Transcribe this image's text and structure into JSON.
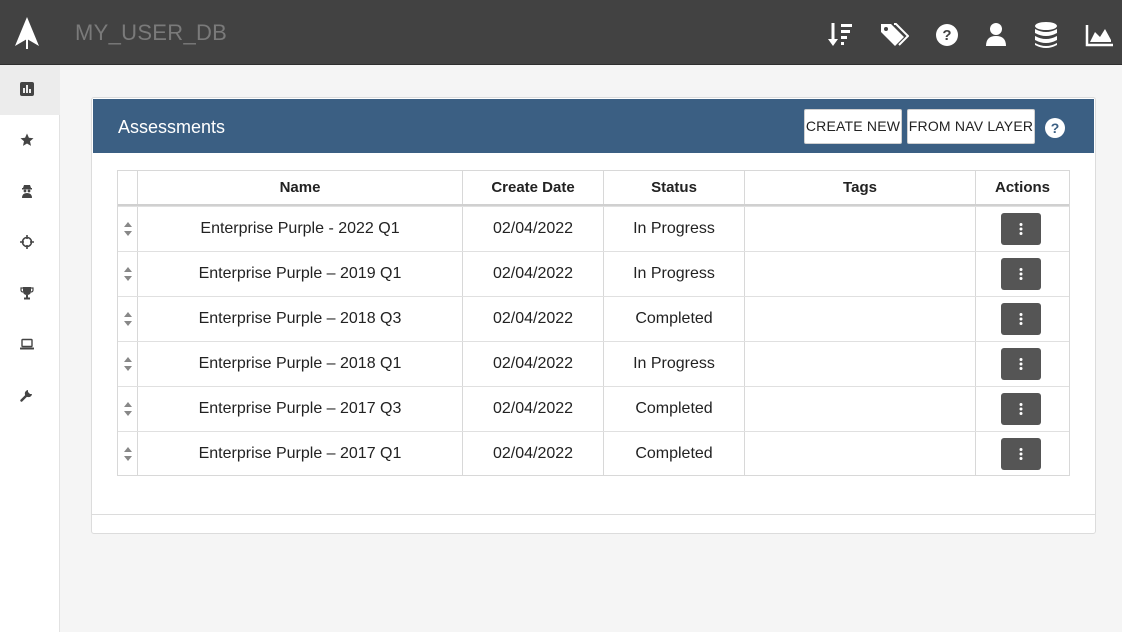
{
  "app": {
    "db_name": "MY_USER_DB",
    "logo": "rocket-logo-icon",
    "top_icons": [
      "sort-icon",
      "tags-icon",
      "help-icon",
      "user-icon",
      "database-icon",
      "area-chart-icon"
    ]
  },
  "sidebar": {
    "items": [
      {
        "icon": "bar-chart-icon",
        "active": true
      },
      {
        "icon": "star-icon",
        "active": false
      },
      {
        "icon": "user-secret-icon",
        "active": false
      },
      {
        "icon": "crosshairs-icon",
        "active": false
      },
      {
        "icon": "trophy-icon",
        "active": false
      },
      {
        "icon": "laptop-icon",
        "active": false
      },
      {
        "icon": "wrench-icon",
        "active": false
      }
    ]
  },
  "panel": {
    "title": "Assessments",
    "create_new_label": "CREATE NEW",
    "from_nav_layer_label": "FROM NAV LAYER",
    "help_icon": "question-circle-icon"
  },
  "table": {
    "columns": [
      "Name",
      "Create Date",
      "Status",
      "Tags",
      "Actions"
    ],
    "rows": [
      {
        "name": "Enterprise Purple - 2022 Q1",
        "create_date": "02/04/2022",
        "status": "In Progress",
        "tags": ""
      },
      {
        "name": "Enterprise Purple – 2019 Q1",
        "create_date": "02/04/2022",
        "status": "In Progress",
        "tags": ""
      },
      {
        "name": "Enterprise Purple – 2018 Q3",
        "create_date": "02/04/2022",
        "status": "Completed",
        "tags": ""
      },
      {
        "name": "Enterprise Purple – 2018 Q1",
        "create_date": "02/04/2022",
        "status": "In Progress",
        "tags": ""
      },
      {
        "name": "Enterprise Purple – 2017 Q3",
        "create_date": "02/04/2022",
        "status": "Completed",
        "tags": ""
      },
      {
        "name": "Enterprise Purple – 2017 Q1",
        "create_date": "02/04/2022",
        "status": "Completed",
        "tags": ""
      }
    ]
  },
  "colors": {
    "topbar": "#424242",
    "panel_header": "#3b5f83",
    "action_button": "#555555",
    "background": "#f5f5f5"
  }
}
